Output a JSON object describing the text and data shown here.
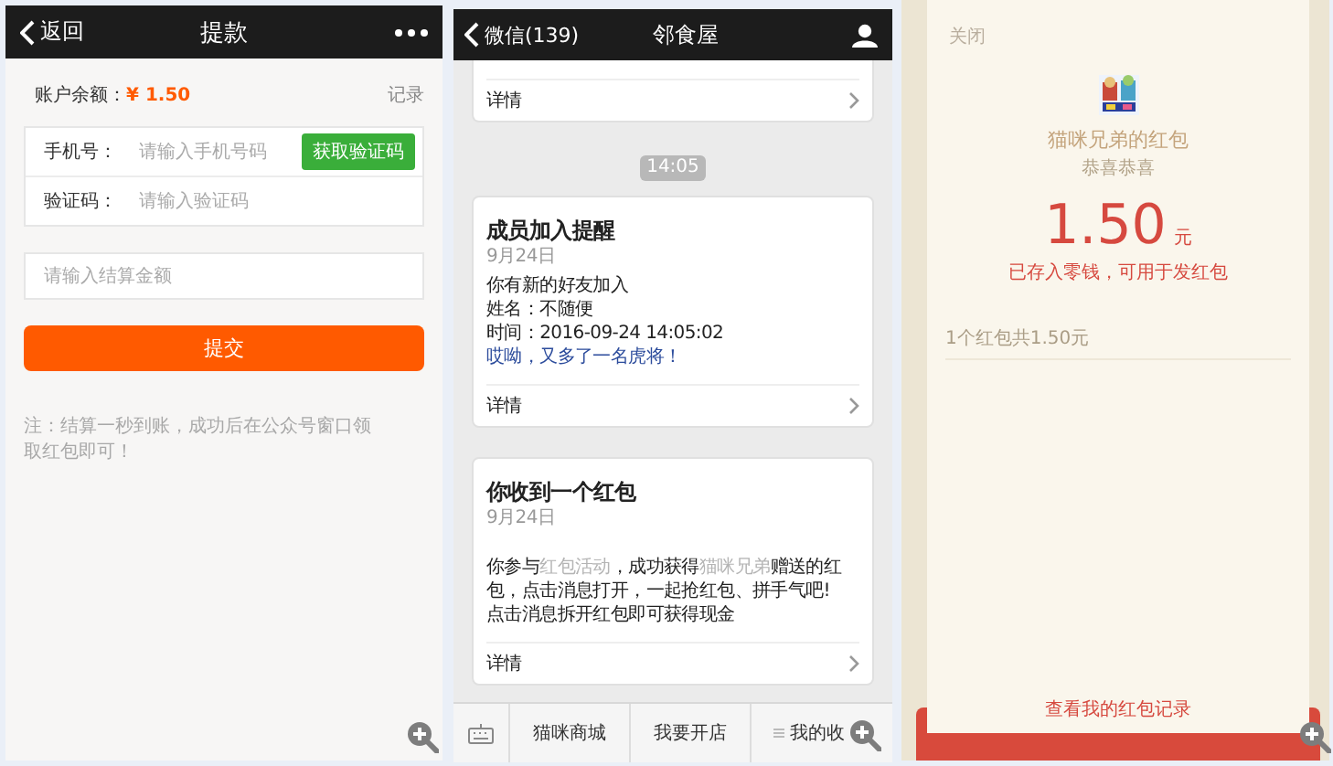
{
  "withdraw_screen": {
    "back": "返回",
    "title": "提款",
    "balance_label": "账户余额：",
    "balance_value": "¥ 1.50",
    "records_link": "记录",
    "phone": {
      "label": "手机号：",
      "placeholder": "请输入手机号码"
    },
    "code_button": "获取验证码",
    "code": {
      "label": "验证码：",
      "placeholder": "请输入验证码"
    },
    "amount": {
      "placeholder": "请输入结算金额"
    },
    "submit": "提交",
    "note": "注：结算一秒到账，成功后在公众号窗口领取红包即可！"
  },
  "chat_screen": {
    "back": "微信(139)",
    "title": "邻食屋",
    "time_pill": "14:05",
    "cards": [
      {
        "kind": "partial",
        "footer": "详情"
      },
      {
        "kind": "lines",
        "title": "成员加入提醒",
        "date": "9月24日",
        "lines": [
          {
            "kind": "plain",
            "text": "你有新的好友加入"
          },
          {
            "kind": "plain",
            "text": "姓名：不随便"
          },
          {
            "kind": "plain",
            "text": "时间：2016-09-24 14:05:02"
          },
          {
            "kind": "highlight",
            "text": "哎呦，又多了一名虎将！"
          }
        ],
        "footer": "详情"
      },
      {
        "kind": "paragraph",
        "title": "你收到一个红包",
        "date": "9月24日",
        "segments": [
          {
            "kind": "plain",
            "text": "你参与"
          },
          {
            "kind": "muted",
            "text": "红包活动"
          },
          {
            "kind": "plain",
            "text": "，成功获得"
          },
          {
            "kind": "muted",
            "text": "猫咪兄弟"
          },
          {
            "kind": "plain",
            "text": "赠送的红包，点击消息打开，一起抢红包、拼手气吧!"
          }
        ],
        "extra": "点击消息拆开红包即可获得现金",
        "footer": "详情"
      }
    ],
    "menu": [
      {
        "kind": "plain",
        "label": "猫咪商城"
      },
      {
        "kind": "plain",
        "label": "我要开店"
      },
      {
        "kind": "submenu",
        "label": "我的收"
      }
    ]
  },
  "red_packet_screen": {
    "close": "关闭",
    "sender": "猫咪兄弟的红包",
    "greeting": "恭喜恭喜",
    "amount": "1.50",
    "unit": "元",
    "status": "已存入零钱，可用于发红包",
    "summary": "1个红包共1.50元",
    "records_link": "查看我的红包记录"
  }
}
